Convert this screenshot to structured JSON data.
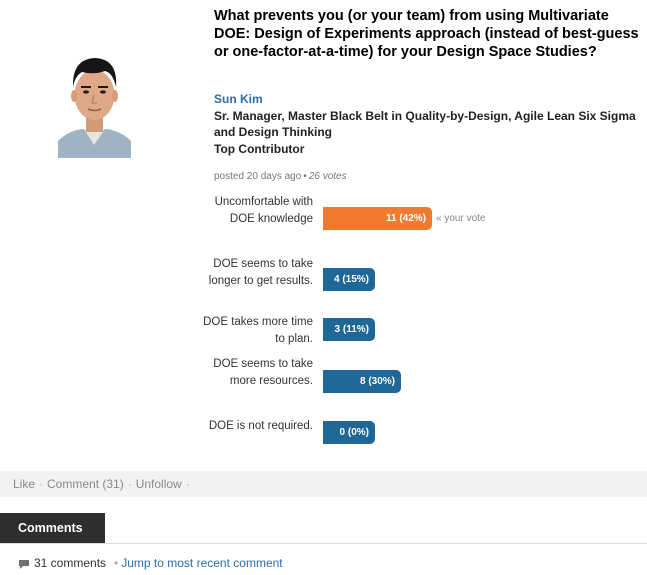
{
  "post": {
    "title": "What prevents you (or your team) from using Multivariate DOE: Design of Experiments approach (instead of best-guess or one-factor-at-a-time) for your Design Space Studies?",
    "author_name": "Sun Kim",
    "author_title": "Sr. Manager, Master Black Belt in Quality-by-Design, Agile Lean Six Sigma and Design Thinking",
    "author_badge": "Top Contributor",
    "posted": "posted 20 days ago",
    "votes": "26 votes"
  },
  "poll": {
    "options": [
      {
        "label": "Uncomfortable with DOE knowledge",
        "count": 11,
        "percent": 42,
        "text": "11  (42%)",
        "color": "#f07a2e",
        "your_vote": true
      },
      {
        "label": "DOE seems to take longer to get results.",
        "count": 4,
        "percent": 15,
        "text": "4  (15%)",
        "color": "#1f6796",
        "your_vote": false
      },
      {
        "label": "DOE takes more time to plan.",
        "count": 3,
        "percent": 11,
        "text": "3  (11%)",
        "color": "#1f6796",
        "your_vote": false
      },
      {
        "label": "DOE seems to take more resources.",
        "count": 8,
        "percent": 30,
        "text": "8  (30%)",
        "color": "#1f6796",
        "your_vote": false
      },
      {
        "label": "DOE is not required.",
        "count": 0,
        "percent": 0,
        "text": "0  (0%)",
        "color": "#1f6796",
        "your_vote": false
      }
    ],
    "your_vote_label": "« your vote"
  },
  "actions": {
    "like": "Like",
    "comment": "Comment (31)",
    "unfollow": "Unfollow",
    "separator": "·"
  },
  "comments": {
    "tab_label": "Comments",
    "icon": "comment-bubble-icon",
    "count_text": "31 comments",
    "jump_link": "Jump to most recent comment"
  }
}
